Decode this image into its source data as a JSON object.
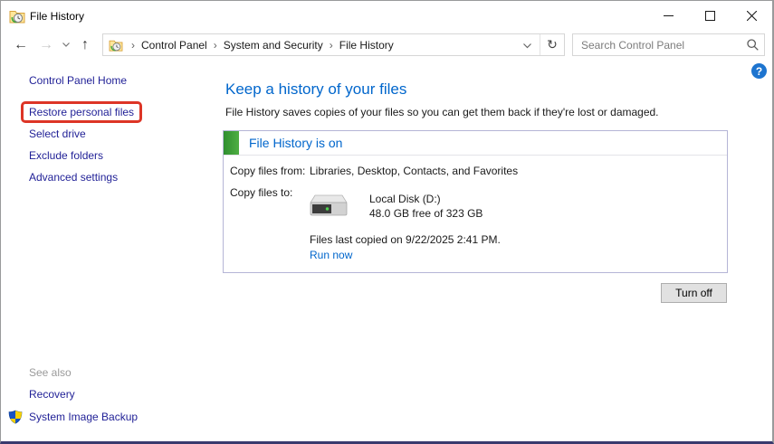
{
  "window": {
    "title": "File History"
  },
  "toolbar": {
    "breadcrumbs": [
      "Control Panel",
      "System and Security",
      "File History"
    ],
    "search_placeholder": "Search Control Panel"
  },
  "icons": {
    "back": "←",
    "forward": "→",
    "up": "↑",
    "refresh": "↻",
    "breadcrumb_separator": "›",
    "help": "?"
  },
  "sidebar": {
    "home_label": "Control Panel Home",
    "tasks": [
      "Restore personal files",
      "Select drive",
      "Exclude folders",
      "Advanced settings"
    ],
    "see_also_label": "See also",
    "see_also_links": [
      "Recovery",
      "System Image Backup"
    ]
  },
  "main": {
    "heading": "Keep a history of your files",
    "description": "File History saves copies of your files so you can get them back if they're lost or damaged.",
    "status_panel": {
      "status_title": "File History is on",
      "copy_from_label": "Copy files from:",
      "copy_from_value": "Libraries, Desktop, Contacts, and Favorites",
      "copy_to_label": "Copy files to:",
      "drive_name": "Local Disk (D:)",
      "drive_space": "48.0 GB free of 323 GB",
      "last_copied": "Files last copied on 9/22/2025 2:41 PM.",
      "run_now_label": "Run now"
    },
    "turn_off_label": "Turn off"
  },
  "colors": {
    "heading_blue": "#0066cc",
    "sidebar_link_navy": "#1f1f96",
    "status_green": "#3b9a39",
    "annotation_red": "#dd3526",
    "help_blue": "#1d74cf"
  }
}
